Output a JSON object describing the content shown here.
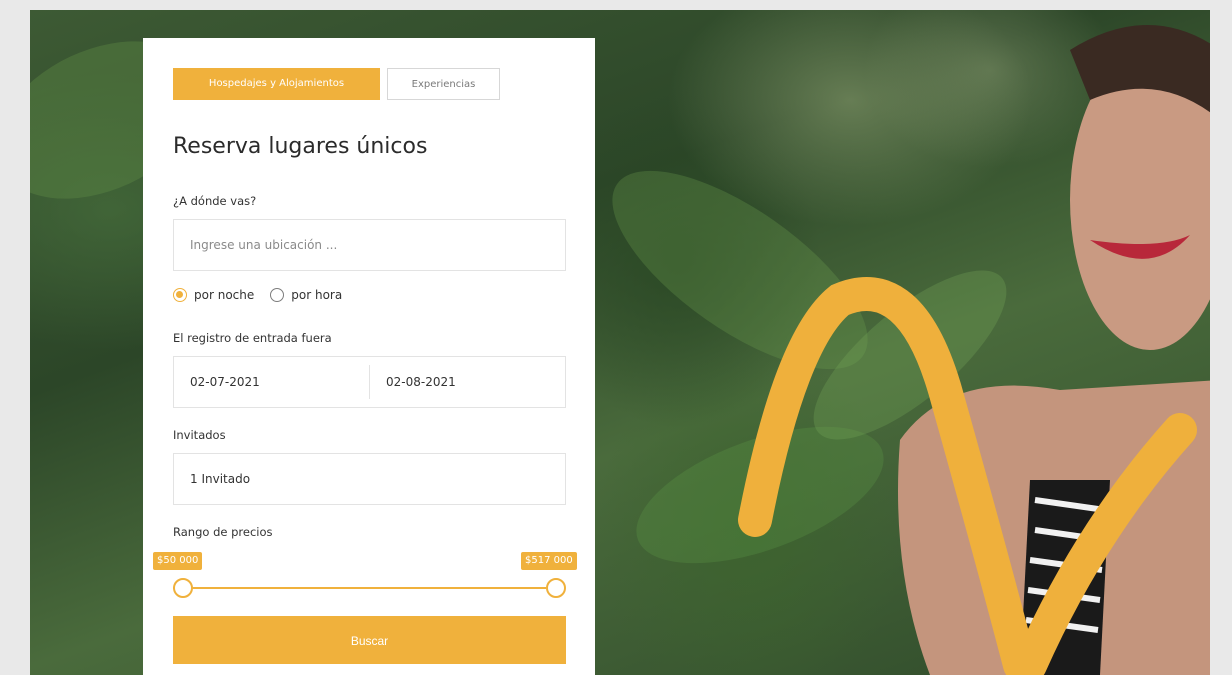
{
  "tabs": [
    {
      "label": "Hospedajes y Alojamientos",
      "active": true
    },
    {
      "label": "Experiencias",
      "active": false
    }
  ],
  "title": "Reserva lugares únicos",
  "location": {
    "label": "¿A dónde vas?",
    "placeholder": "Ingrese una ubicación ..."
  },
  "rate_options": [
    {
      "label": "por noche",
      "selected": true
    },
    {
      "label": "por hora",
      "selected": false
    }
  ],
  "checkin": {
    "label": "El registro de entrada fuera",
    "start": "02-07-2021",
    "end": "02-08-2021"
  },
  "guests": {
    "label": "Invitados",
    "value": "1 Invitado"
  },
  "price_range": {
    "label": "Rango de precios",
    "min": "$50 000",
    "max": "$517 000"
  },
  "search_button": "Buscar",
  "colors": {
    "accent": "#f0b13c"
  }
}
